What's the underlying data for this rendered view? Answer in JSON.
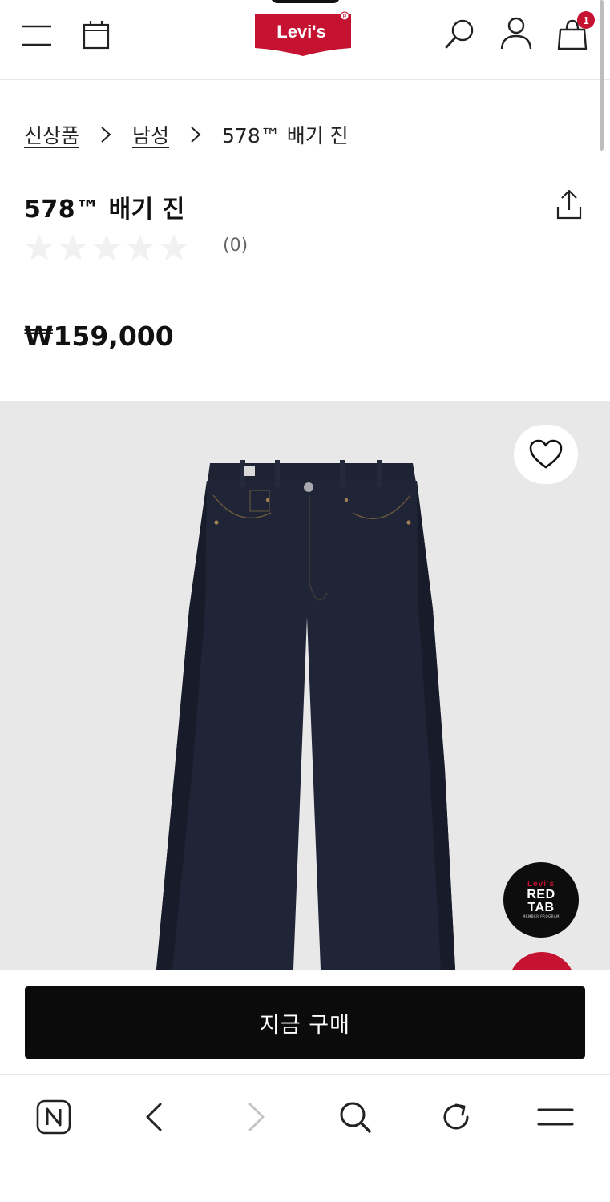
{
  "header": {
    "logo_text": "Levi's",
    "cart_count": "1",
    "icons": [
      "menu-icon",
      "calendar-icon",
      "search-icon",
      "user-icon",
      "cart-icon"
    ]
  },
  "breadcrumb": {
    "items": [
      "신상품",
      "남성",
      "578™ 배기 진"
    ]
  },
  "product": {
    "title": "578™ 배기 진",
    "rating": 0,
    "rating_max": 5,
    "review_count": "(0)",
    "price": "₩159,000"
  },
  "overlay": {
    "redtab_brand": "Levi's",
    "redtab_line1": "RED",
    "redtab_line2": "TAB",
    "redtab_sub": "MEMBER PROGRAM"
  },
  "buy_bar": {
    "buy_label": "지금 구매"
  },
  "browser_bar": {
    "icons": [
      "naver-icon",
      "back-icon",
      "forward-icon",
      "search-icon",
      "refresh-icon",
      "menu-icon"
    ]
  },
  "colors": {
    "brand_red": "#c41230",
    "buy_button": "#0b0b0b",
    "image_bg": "#e8e8e9"
  }
}
